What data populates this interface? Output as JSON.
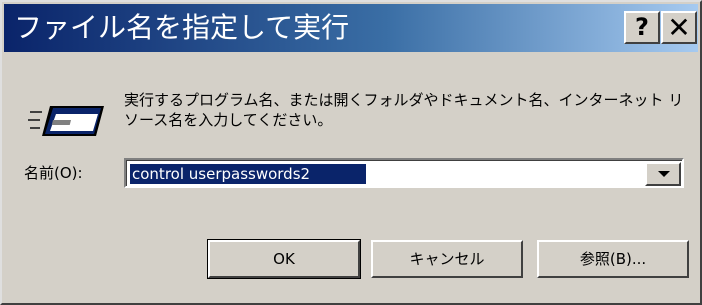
{
  "window": {
    "title": "ファイル名を指定して実行",
    "help_label": "?",
    "close_label": "✕"
  },
  "dialog": {
    "description": "実行するプログラム名、または開くフォルダやドキュメント名、インターネット リソース名を入力してください。",
    "name_label": "名前(O):",
    "command_value": "control userpasswords2",
    "icon": "run-icon"
  },
  "buttons": {
    "ok": "OK",
    "cancel": "キャンセル",
    "browse": "参照(B)..."
  },
  "colors": {
    "title_start": "#0a246a",
    "title_end": "#a6caf0",
    "face": "#d4d0c8",
    "selection": "#0a246a"
  }
}
